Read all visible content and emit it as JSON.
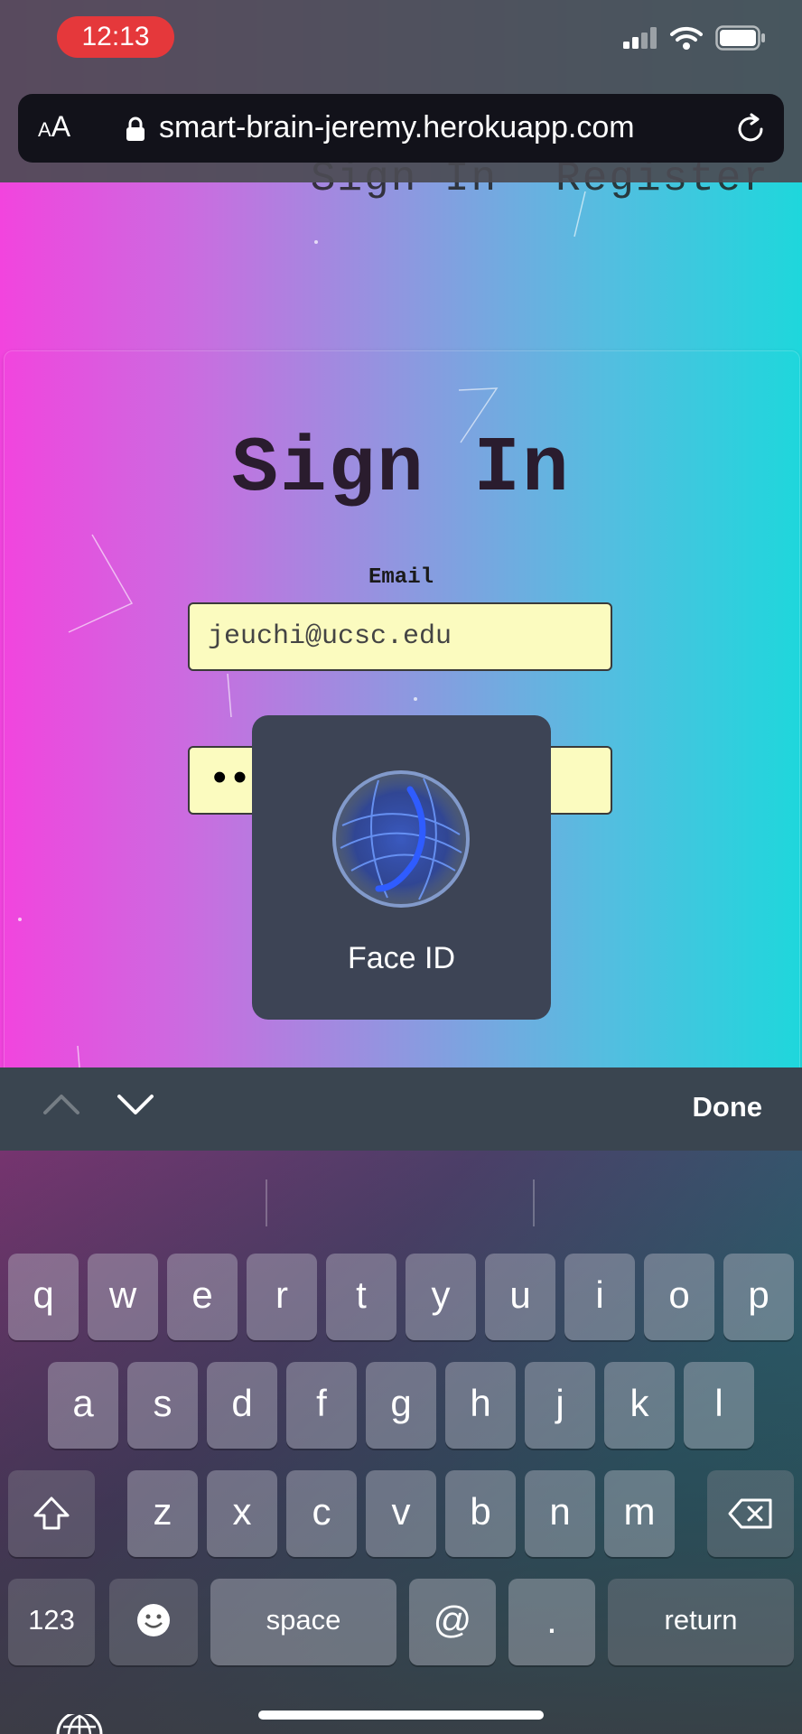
{
  "status_bar": {
    "time": "12:13"
  },
  "browser": {
    "aa_small": "A",
    "aa_large": "A",
    "url": "smart-brain-jeremy.herokuapp.com"
  },
  "nav": {
    "links": [
      "Sign In",
      "Register"
    ]
  },
  "form": {
    "title": "Sign In",
    "email_label": "Email",
    "email_value": "jeuchi@ucsc.edu",
    "password_value": "•••"
  },
  "faceid": {
    "label": "Face ID"
  },
  "accessory": {
    "done_label": "Done"
  },
  "keyboard": {
    "row1": [
      "q",
      "w",
      "e",
      "r",
      "t",
      "y",
      "u",
      "i",
      "o",
      "p"
    ],
    "row2": [
      "a",
      "s",
      "d",
      "f",
      "g",
      "h",
      "j",
      "k",
      "l"
    ],
    "row3": [
      "z",
      "x",
      "c",
      "v",
      "b",
      "n",
      "m"
    ],
    "numbers_label": "123",
    "space_label": "space",
    "at_label": "@",
    "dot_label": ".",
    "return_label": "return"
  },
  "colors": {
    "field_bg": "#fbfbbf",
    "badge": "#e5383b",
    "gradient_left": "#f244de",
    "gradient_right": "#1ed7dc"
  }
}
